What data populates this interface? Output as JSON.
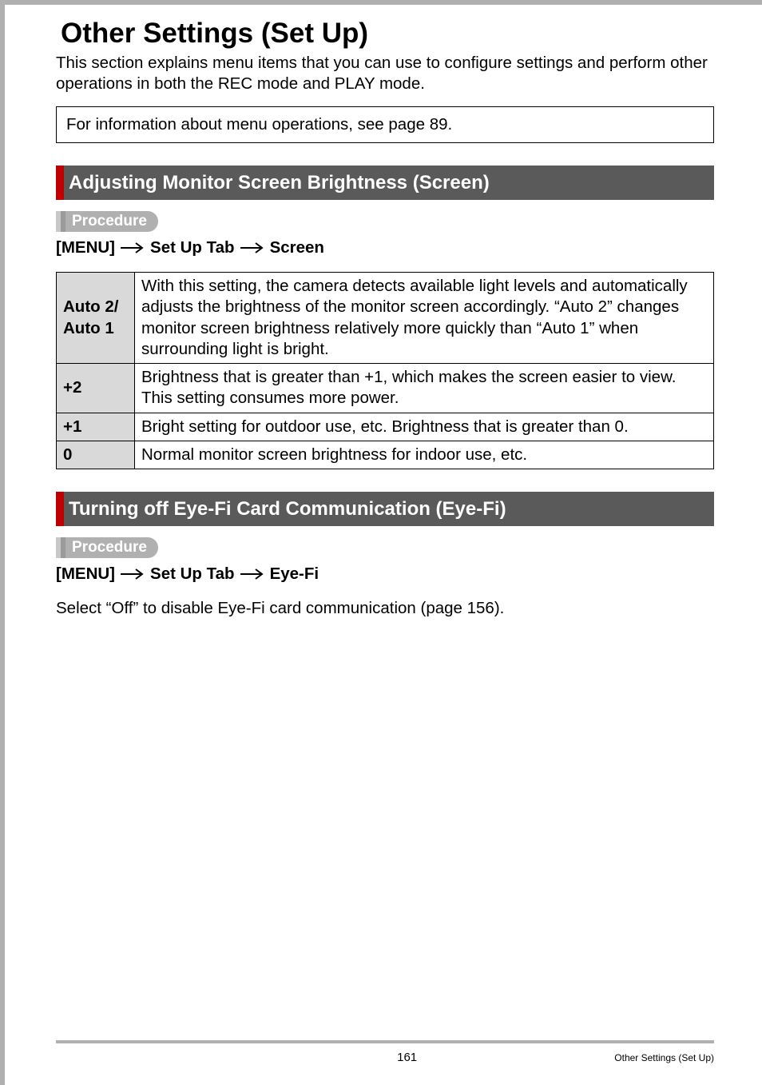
{
  "page_title": "Other Settings (Set Up)",
  "intro_text": "This section explains menu items that you can use to configure settings and perform other operations in both the REC mode and PLAY mode.",
  "info_box": "For information about menu operations, see page 89.",
  "sections": [
    {
      "heading": "Adjusting Monitor Screen Brightness (Screen)",
      "procedure_label": "Procedure",
      "menu_path": [
        "[MENU]",
        "Set Up Tab",
        "Screen"
      ],
      "table": [
        {
          "setting": "Auto 2/\nAuto 1",
          "desc": "With this setting, the camera detects available light levels and automatically adjusts the brightness of the monitor screen accordingly. “Auto 2” changes monitor screen brightness relatively more quickly than “Auto 1” when surrounding light is bright."
        },
        {
          "setting": "+2",
          "desc": "Brightness that is greater than +1, which makes the screen easier to view. This setting consumes more power."
        },
        {
          "setting": "+1",
          "desc": "Bright setting for outdoor use, etc. Brightness that is greater than 0."
        },
        {
          "setting": "0",
          "desc": "Normal monitor screen brightness for indoor use, etc."
        }
      ]
    },
    {
      "heading": "Turning off Eye-Fi Card Communication (Eye-Fi)",
      "procedure_label": "Procedure",
      "menu_path": [
        "[MENU]",
        "Set Up Tab",
        "Eye-Fi"
      ],
      "body": "Select “Off” to disable Eye-Fi card communication (page 156)."
    }
  ],
  "footer": {
    "page_number": "161",
    "section_name": "Other Settings (Set Up)"
  }
}
